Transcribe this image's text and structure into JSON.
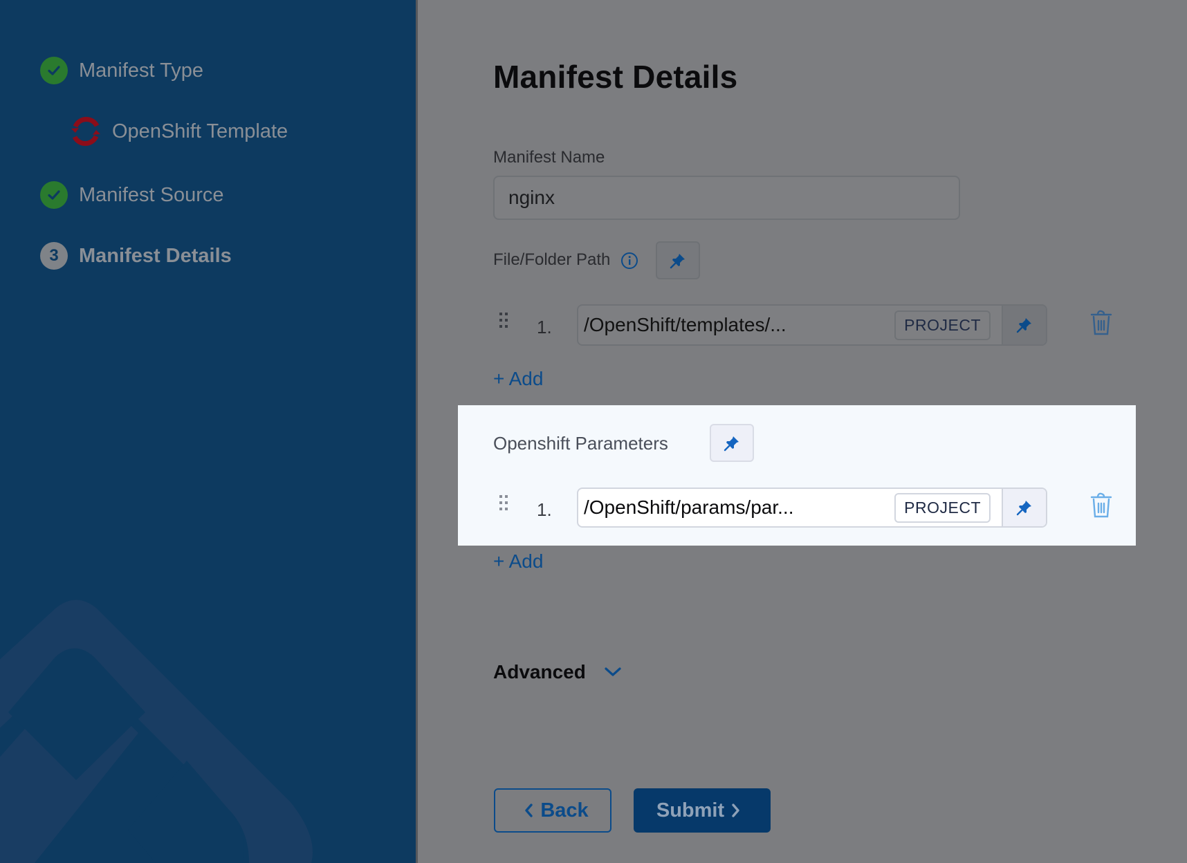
{
  "sidebar": {
    "steps": [
      {
        "label": "Manifest Type",
        "status": "complete",
        "icon": "check-circle-icon"
      },
      {
        "label": "OpenShift Template",
        "status": "selected-value",
        "icon": "openshift-icon"
      },
      {
        "label": "Manifest Source",
        "status": "complete",
        "icon": "check-circle-icon"
      },
      {
        "label": "Manifest Details",
        "status": "current",
        "number": "3"
      }
    ]
  },
  "main": {
    "title": "Manifest Details",
    "manifest_name": {
      "label": "Manifest Name",
      "value": "nginx"
    },
    "file_folder_path": {
      "label": "File/Folder Path",
      "info_icon": "info-icon",
      "rows": [
        {
          "index": "1.",
          "value": "/OpenShift/templates/...",
          "badge": "PROJECT"
        }
      ],
      "add_label": "+ Add"
    },
    "openshift_parameters": {
      "label": "Openshift Parameters",
      "rows": [
        {
          "index": "1.",
          "value": "/OpenShift/params/par...",
          "badge": "PROJECT"
        }
      ],
      "add_label": "+ Add"
    },
    "advanced_label": "Advanced",
    "back_label": "Back",
    "submit_label": "Submit"
  },
  "colors": {
    "sidebar_bg": "#0d3a60",
    "accent": "#0b4b8a",
    "success": "#2a7a2e",
    "highlight_bg": "#f5f9fd",
    "overlay_bg": "#7c7d80"
  }
}
